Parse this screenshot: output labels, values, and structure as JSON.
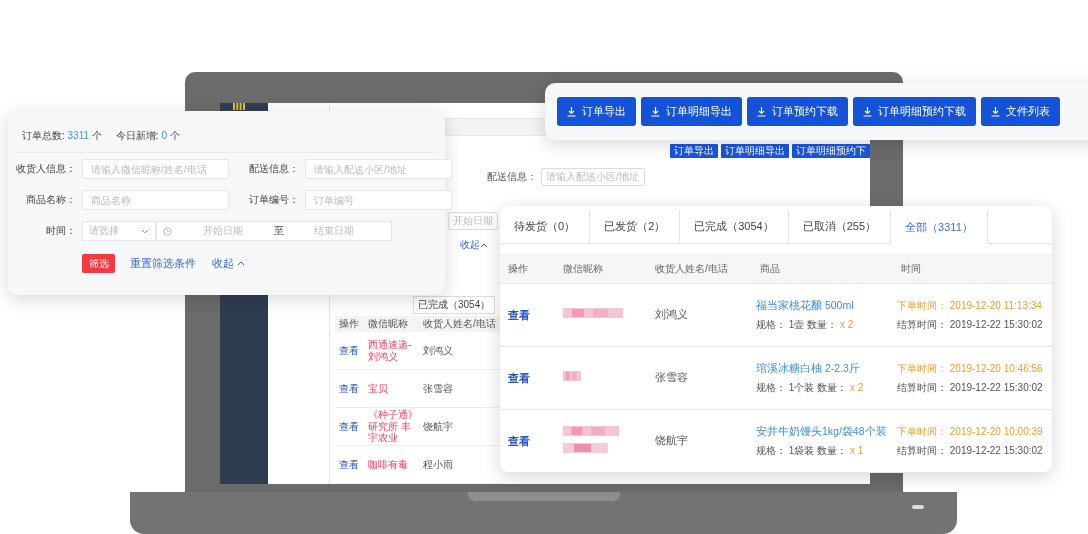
{
  "laptop_screen": {
    "toolbar_buttons": [
      "订单导出",
      "订单明细导出",
      "订单明细预约下"
    ],
    "filter": {
      "label": "配送信息：",
      "placeholder": "请输入配送小区/地址",
      "date_placeholder": "开始日期",
      "collapse": "收起"
    },
    "tab": "已完成（3054）",
    "table": {
      "columns": [
        "操作",
        "微信昵称",
        "收货人姓名/电话"
      ],
      "rows": [
        {
          "action": "查看",
          "nickname": "西通速递-刘鸿义",
          "receiver": "刘鸿义"
        },
        {
          "action": "查看",
          "nickname": "宝贝",
          "receiver": "张雪容"
        },
        {
          "action": "查看",
          "nickname": "《种子通》研究所 丰宇农业",
          "receiver": "饶航宇"
        },
        {
          "action": "查看",
          "nickname": "咖啡有毒",
          "receiver": "程小雨"
        }
      ]
    }
  },
  "filter_panel": {
    "stats": [
      {
        "label": "订单总数:",
        "value": "3311",
        "unit": "个"
      },
      {
        "label": "今日新增:",
        "value": "0",
        "unit": "个"
      }
    ],
    "fields": [
      {
        "label": "收货人信息：",
        "placeholder": "请输入微信昵称/姓名/电话"
      },
      {
        "label": "配送信息：",
        "placeholder": "请输入配送小区/地址"
      },
      {
        "label": "商品名称：",
        "placeholder": "商品名称"
      },
      {
        "label": "订单编号：",
        "placeholder": "订单编号"
      }
    ],
    "time": {
      "label": "时间：",
      "select_placeholder": "请选择",
      "start_placeholder": "开始日期",
      "separator": "至",
      "end_placeholder": "结束日期"
    },
    "filter_button": "筛选",
    "reset_link": "重置筛选条件",
    "collapse_link": "收起"
  },
  "export_toolbar": {
    "buttons": [
      "订单导出",
      "订单明细导出",
      "订单预约下载",
      "订单明细预约下载",
      "文件列表"
    ]
  },
  "orders_panel": {
    "tabs": [
      {
        "label": "待发货（0）",
        "selected": false
      },
      {
        "label": "已发货（2）",
        "selected": false
      },
      {
        "label": "已完成（3054）",
        "selected": false
      },
      {
        "label": "已取消（255）",
        "selected": false
      },
      {
        "label": "全部（3311）",
        "selected": true
      }
    ],
    "columns": [
      "操作",
      "微信昵称",
      "收货人姓名/电话",
      "商品",
      "时间"
    ],
    "rows": [
      {
        "action": "查看",
        "receiver": "刘鸿义",
        "product": "福当家桃花酿 500ml",
        "spec_line": "规格： 1壶 数量：",
        "quantity": "x 2",
        "order_time": "下单时间： 2019-12-20 11:13:34",
        "settle_time": "结算时间： 2019-12-22 15:30:02"
      },
      {
        "action": "查看",
        "receiver": "张雪容",
        "product": "琯溪冰糖白柚 2-2.3斤",
        "spec_line": "规格： 1个装 数量：",
        "quantity": "x 2",
        "order_time": "下单时间： 2019-12-20 10:46:56",
        "settle_time": "结算时间： 2019-12-22 15:30:02"
      },
      {
        "action": "查看",
        "receiver": "饶航宇",
        "product": "安井牛奶馒头1kg/袋48个装",
        "spec_line": "规格： 1袋装 数量：",
        "quantity": "x 1",
        "order_time": "下单时间： 2019-12-20 10:00:39",
        "settle_time": "结算时间： 2019-12-22 15:30:02"
      }
    ]
  }
}
